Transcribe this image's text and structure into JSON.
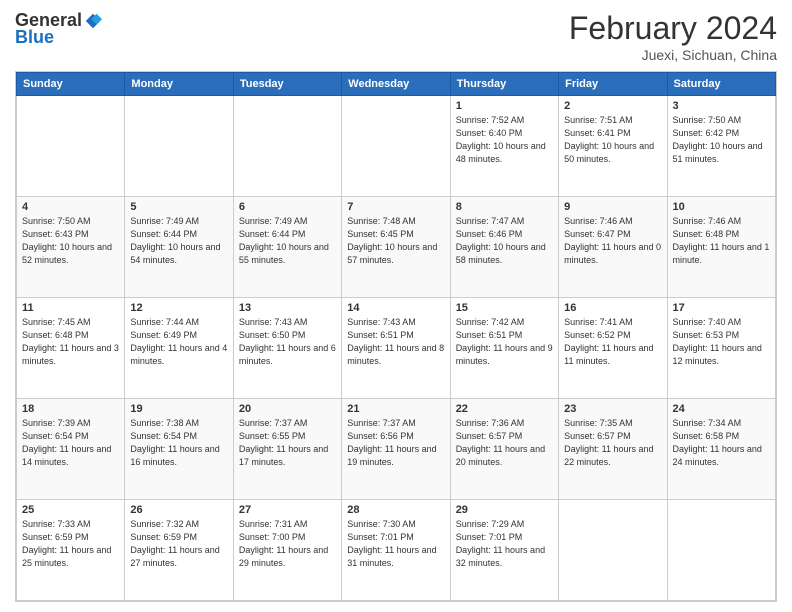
{
  "logo": {
    "general": "General",
    "blue": "Blue"
  },
  "title": "February 2024",
  "subtitle": "Juexi, Sichuan, China",
  "days_of_week": [
    "Sunday",
    "Monday",
    "Tuesday",
    "Wednesday",
    "Thursday",
    "Friday",
    "Saturday"
  ],
  "weeks": [
    [
      {
        "num": "",
        "info": ""
      },
      {
        "num": "",
        "info": ""
      },
      {
        "num": "",
        "info": ""
      },
      {
        "num": "",
        "info": ""
      },
      {
        "num": "1",
        "info": "Sunrise: 7:52 AM\nSunset: 6:40 PM\nDaylight: 10 hours and 48 minutes."
      },
      {
        "num": "2",
        "info": "Sunrise: 7:51 AM\nSunset: 6:41 PM\nDaylight: 10 hours and 50 minutes."
      },
      {
        "num": "3",
        "info": "Sunrise: 7:50 AM\nSunset: 6:42 PM\nDaylight: 10 hours and 51 minutes."
      }
    ],
    [
      {
        "num": "4",
        "info": "Sunrise: 7:50 AM\nSunset: 6:43 PM\nDaylight: 10 hours and 52 minutes."
      },
      {
        "num": "5",
        "info": "Sunrise: 7:49 AM\nSunset: 6:44 PM\nDaylight: 10 hours and 54 minutes."
      },
      {
        "num": "6",
        "info": "Sunrise: 7:49 AM\nSunset: 6:44 PM\nDaylight: 10 hours and 55 minutes."
      },
      {
        "num": "7",
        "info": "Sunrise: 7:48 AM\nSunset: 6:45 PM\nDaylight: 10 hours and 57 minutes."
      },
      {
        "num": "8",
        "info": "Sunrise: 7:47 AM\nSunset: 6:46 PM\nDaylight: 10 hours and 58 minutes."
      },
      {
        "num": "9",
        "info": "Sunrise: 7:46 AM\nSunset: 6:47 PM\nDaylight: 11 hours and 0 minutes."
      },
      {
        "num": "10",
        "info": "Sunrise: 7:46 AM\nSunset: 6:48 PM\nDaylight: 11 hours and 1 minute."
      }
    ],
    [
      {
        "num": "11",
        "info": "Sunrise: 7:45 AM\nSunset: 6:48 PM\nDaylight: 11 hours and 3 minutes."
      },
      {
        "num": "12",
        "info": "Sunrise: 7:44 AM\nSunset: 6:49 PM\nDaylight: 11 hours and 4 minutes."
      },
      {
        "num": "13",
        "info": "Sunrise: 7:43 AM\nSunset: 6:50 PM\nDaylight: 11 hours and 6 minutes."
      },
      {
        "num": "14",
        "info": "Sunrise: 7:43 AM\nSunset: 6:51 PM\nDaylight: 11 hours and 8 minutes."
      },
      {
        "num": "15",
        "info": "Sunrise: 7:42 AM\nSunset: 6:51 PM\nDaylight: 11 hours and 9 minutes."
      },
      {
        "num": "16",
        "info": "Sunrise: 7:41 AM\nSunset: 6:52 PM\nDaylight: 11 hours and 11 minutes."
      },
      {
        "num": "17",
        "info": "Sunrise: 7:40 AM\nSunset: 6:53 PM\nDaylight: 11 hours and 12 minutes."
      }
    ],
    [
      {
        "num": "18",
        "info": "Sunrise: 7:39 AM\nSunset: 6:54 PM\nDaylight: 11 hours and 14 minutes."
      },
      {
        "num": "19",
        "info": "Sunrise: 7:38 AM\nSunset: 6:54 PM\nDaylight: 11 hours and 16 minutes."
      },
      {
        "num": "20",
        "info": "Sunrise: 7:37 AM\nSunset: 6:55 PM\nDaylight: 11 hours and 17 minutes."
      },
      {
        "num": "21",
        "info": "Sunrise: 7:37 AM\nSunset: 6:56 PM\nDaylight: 11 hours and 19 minutes."
      },
      {
        "num": "22",
        "info": "Sunrise: 7:36 AM\nSunset: 6:57 PM\nDaylight: 11 hours and 20 minutes."
      },
      {
        "num": "23",
        "info": "Sunrise: 7:35 AM\nSunset: 6:57 PM\nDaylight: 11 hours and 22 minutes."
      },
      {
        "num": "24",
        "info": "Sunrise: 7:34 AM\nSunset: 6:58 PM\nDaylight: 11 hours and 24 minutes."
      }
    ],
    [
      {
        "num": "25",
        "info": "Sunrise: 7:33 AM\nSunset: 6:59 PM\nDaylight: 11 hours and 25 minutes."
      },
      {
        "num": "26",
        "info": "Sunrise: 7:32 AM\nSunset: 6:59 PM\nDaylight: 11 hours and 27 minutes."
      },
      {
        "num": "27",
        "info": "Sunrise: 7:31 AM\nSunset: 7:00 PM\nDaylight: 11 hours and 29 minutes."
      },
      {
        "num": "28",
        "info": "Sunrise: 7:30 AM\nSunset: 7:01 PM\nDaylight: 11 hours and 31 minutes."
      },
      {
        "num": "29",
        "info": "Sunrise: 7:29 AM\nSunset: 7:01 PM\nDaylight: 11 hours and 32 minutes."
      },
      {
        "num": "",
        "info": ""
      },
      {
        "num": "",
        "info": ""
      }
    ]
  ]
}
